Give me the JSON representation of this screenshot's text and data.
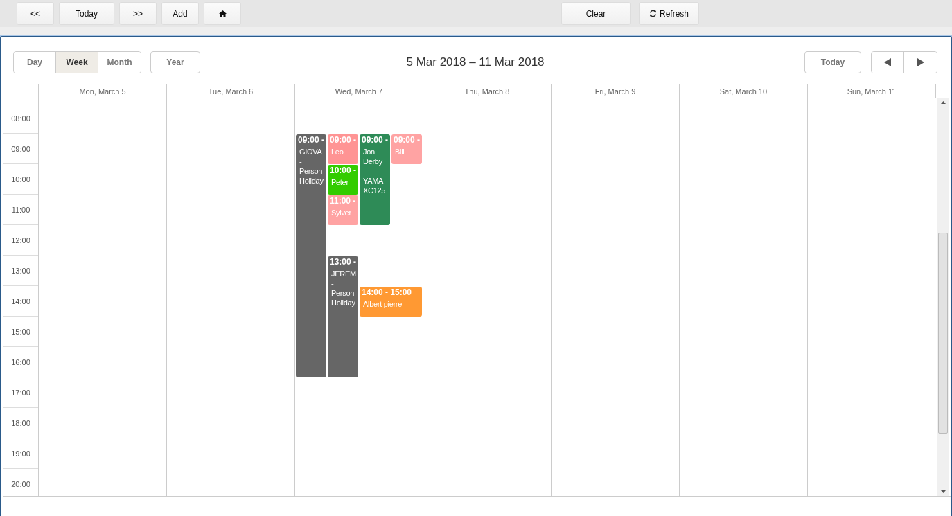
{
  "toolbar": {
    "left_buttons": [
      {
        "kind": "text",
        "label": "<<"
      },
      {
        "kind": "text",
        "label": "Today"
      },
      {
        "kind": "text",
        "label": ">>"
      },
      {
        "kind": "text",
        "label": "Add"
      },
      {
        "kind": "home"
      }
    ],
    "right_buttons": [
      {
        "kind": "text",
        "label": "Clear"
      },
      {
        "kind": "refresh",
        "label": "Refresh"
      }
    ]
  },
  "views": [
    {
      "label": "Day",
      "selected": false
    },
    {
      "label": "Week",
      "selected": true
    },
    {
      "label": "Month",
      "selected": false
    }
  ],
  "year_button": "Year",
  "title": "5 Mar 2018 – 11 Mar 2018",
  "today_button": "Today",
  "days": [
    "Mon, March 5",
    "Tue, March 6",
    "Wed, March 7",
    "Thu, March 8",
    "Fri, March 9",
    "Sat, March 10",
    "Sun, March 11"
  ],
  "hours": [
    "08:00",
    "09:00",
    "10:00",
    "11:00",
    "12:00",
    "13:00",
    "14:00",
    "15:00",
    "16:00",
    "17:00",
    "18:00",
    "19:00",
    "20:00"
  ],
  "events": [
    {
      "color": "#666666",
      "time": "09:00 -",
      "lines": [
        "GIOVA",
        "-",
        "Person",
        "Holiday"
      ]
    },
    {
      "color": "#ff9494",
      "time": "09:00 -",
      "lines": [
        "Leo"
      ]
    },
    {
      "color": "#33cc00",
      "time": "10:00 -",
      "lines": [
        "Peter"
      ]
    },
    {
      "color": "#ffa3a3",
      "time": "11:00 -",
      "lines": [
        "Sylver"
      ]
    },
    {
      "color": "#666666",
      "time": "13:00 -",
      "lines": [
        "JEREM",
        "-",
        "Person",
        "Holiday"
      ]
    },
    {
      "color": "#2e8b57",
      "time": "09:00 -",
      "lines": [
        "Jon",
        "Derby",
        "-",
        "YAMA",
        "XC125"
      ]
    },
    {
      "color": "#ffa3a3",
      "time": "09:00 -",
      "lines": [
        "Bill"
      ]
    },
    {
      "color": "#ff9933",
      "time": "14:00 - 15:00",
      "lines": [
        "Albert pierre -"
      ]
    }
  ]
}
